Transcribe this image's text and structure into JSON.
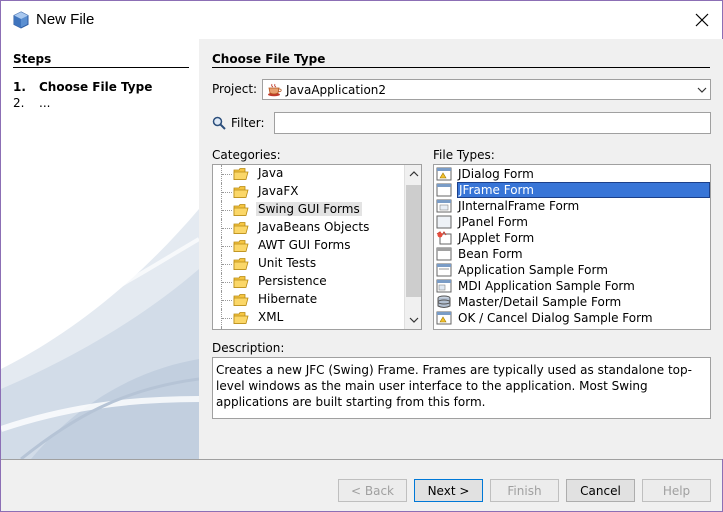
{
  "window": {
    "title": "New File"
  },
  "steps": {
    "title": "Steps",
    "items": [
      {
        "num": "1.",
        "label": "Choose File Type"
      },
      {
        "num": "2.",
        "label": "..."
      }
    ]
  },
  "main": {
    "section_title": "Choose File Type",
    "project_label": "Project:",
    "project_value": "JavaApplication2",
    "filter_label": "Filter:",
    "filter_value": "",
    "categories_label": "Categories:",
    "file_types_label": "File Types:",
    "categories": [
      {
        "label": "Java",
        "selected": false
      },
      {
        "label": "JavaFX",
        "selected": false
      },
      {
        "label": "Swing GUI Forms",
        "selected": true
      },
      {
        "label": "JavaBeans Objects",
        "selected": false
      },
      {
        "label": "AWT GUI Forms",
        "selected": false
      },
      {
        "label": "Unit Tests",
        "selected": false
      },
      {
        "label": "Persistence",
        "selected": false
      },
      {
        "label": "Hibernate",
        "selected": false
      },
      {
        "label": "XML",
        "selected": false
      }
    ],
    "file_types": [
      {
        "label": "JDialog Form",
        "icon": "dialog-form-icon",
        "selected": false
      },
      {
        "label": "JFrame Form",
        "icon": "frame-form-icon",
        "selected": true
      },
      {
        "label": "JInternalFrame Form",
        "icon": "internal-frame-icon",
        "selected": false
      },
      {
        "label": "JPanel Form",
        "icon": "panel-form-icon",
        "selected": false
      },
      {
        "label": "JApplet Form",
        "icon": "applet-form-icon",
        "selected": false
      },
      {
        "label": "Bean Form",
        "icon": "bean-form-icon",
        "selected": false
      },
      {
        "label": "Application Sample Form",
        "icon": "application-form-icon",
        "selected": false
      },
      {
        "label": "MDI Application Sample Form",
        "icon": "mdi-form-icon",
        "selected": false
      },
      {
        "label": "Master/Detail Sample Form",
        "icon": "database-form-icon",
        "selected": false
      },
      {
        "label": "OK / Cancel Dialog Sample Form",
        "icon": "dialog-form-icon",
        "selected": false
      }
    ],
    "description_label": "Description:",
    "description_text": "Creates a new JFC (Swing) Frame. Frames are typically used as standalone top-level windows as the main user interface to the application. Most Swing applications are built starting from this form."
  },
  "buttons": {
    "back": "< Back",
    "next": "Next >",
    "finish": "Finish",
    "cancel": "Cancel",
    "help": "Help"
  },
  "colors": {
    "selection": "#3875d7",
    "panel_bg": "#f0f0f0",
    "window_border": "#8c6fb5"
  }
}
